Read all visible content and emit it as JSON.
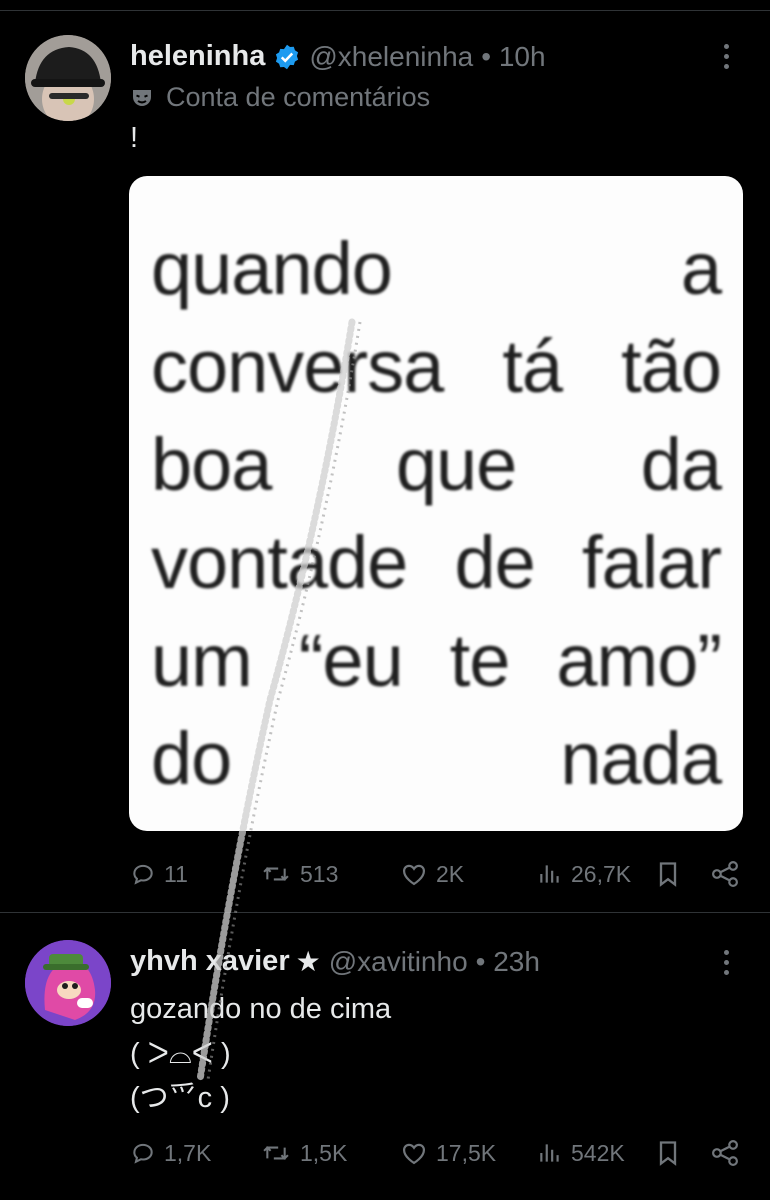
{
  "tweet1": {
    "name": "heleninha",
    "handle": "@xheleninha",
    "time": "• 10h",
    "label": "Conta de comentários",
    "text": "!",
    "meme_lines": [
      [
        "quando",
        "a"
      ],
      [
        "conversa",
        "tá",
        "tão"
      ],
      [
        "boa",
        "que",
        "da"
      ],
      [
        "vontade",
        "de",
        "falar"
      ],
      [
        "um",
        "“eu",
        "te",
        "amo”"
      ],
      [
        "do",
        "nada"
      ]
    ],
    "stats": {
      "replies": "11",
      "reposts": "513",
      "likes": "2K",
      "views": "26,7K"
    }
  },
  "tweet2": {
    "name": "yhvh xavier",
    "star": "★",
    "handle": "@xavitinho",
    "time": "• 23h",
    "text_lines": [
      "gozando no de cima",
      "( ᐳ⌓ᐸ )",
      "(つ⺤c )"
    ],
    "stats": {
      "replies": "1,7K",
      "reposts": "1,5K",
      "likes": "17,5K",
      "views": "542K"
    }
  },
  "colors": {
    "background": "#000000",
    "text": "#e7e9ea",
    "muted": "#71767b",
    "verified": "#1d9bf0",
    "divider": "#2f3336"
  },
  "icons": [
    "verified-icon",
    "mask-icon",
    "more-icon",
    "reply-icon",
    "repost-icon",
    "like-icon",
    "views-icon",
    "bookmark-icon",
    "share-icon"
  ]
}
